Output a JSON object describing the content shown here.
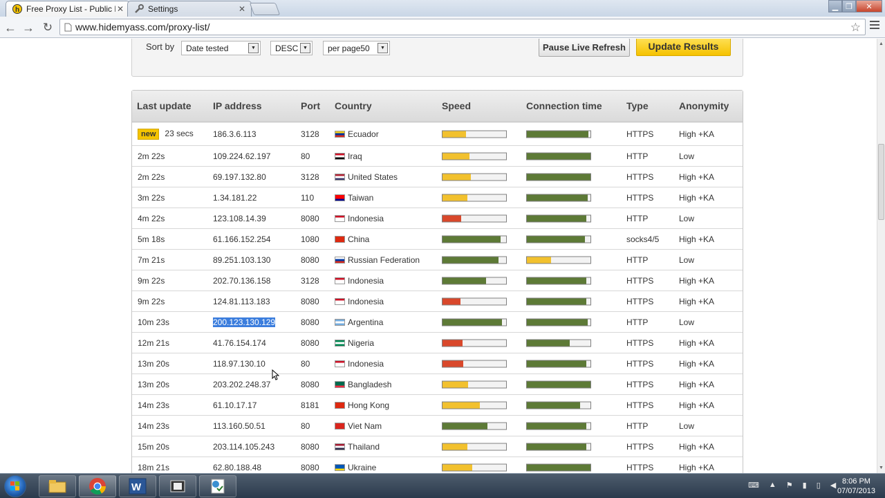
{
  "browser": {
    "tabs": [
      {
        "title": "Free Proxy List - Public Pro",
        "active": true
      },
      {
        "title": "Settings",
        "active": false
      }
    ],
    "url": "www.hidemyass.com/proxy-list/"
  },
  "filters": {
    "sort_by_label": "Sort by",
    "sort_field": "Date tested",
    "sort_order": "DESC",
    "per_page": "per page50",
    "pause_button": "Pause Live Refresh",
    "update_button": "Update Results"
  },
  "table": {
    "headers": [
      "Last update",
      "IP address",
      "Port",
      "Country",
      "Speed",
      "Connection time",
      "Type",
      "Anonymity"
    ],
    "new_badge": "new",
    "rows": [
      {
        "last_update": "23 secs",
        "ip": "186.3.6.113",
        "port": "3128",
        "country": "Ecuador",
        "speed": 0.37,
        "speed_color": "#f2c12e",
        "conn": 0.97,
        "conn_color": "#5d7a36",
        "type": "HTTPS",
        "anonymity": "High +KA",
        "is_new": true
      },
      {
        "last_update": "2m 22s",
        "ip": "109.224.62.197",
        "port": "80",
        "country": "Iraq",
        "speed": 0.42,
        "speed_color": "#f2c12e",
        "conn": 1.0,
        "conn_color": "#5d7a36",
        "type": "HTTP",
        "anonymity": "Low"
      },
      {
        "last_update": "2m 22s",
        "ip": "69.197.132.80",
        "port": "3128",
        "country": "United States",
        "speed": 0.45,
        "speed_color": "#f2c12e",
        "conn": 1.0,
        "conn_color": "#5d7a36",
        "type": "HTTPS",
        "anonymity": "High +KA"
      },
      {
        "last_update": "3m 22s",
        "ip": "1.34.181.22",
        "port": "110",
        "country": "Taiwan",
        "speed": 0.39,
        "speed_color": "#f2c12e",
        "conn": 0.96,
        "conn_color": "#5d7a36",
        "type": "HTTPS",
        "anonymity": "High +KA"
      },
      {
        "last_update": "4m 22s",
        "ip": "123.108.14.39",
        "port": "8080",
        "country": "Indonesia",
        "speed": 0.29,
        "speed_color": "#d9482b",
        "conn": 0.93,
        "conn_color": "#5d7a36",
        "type": "HTTP",
        "anonymity": "Low"
      },
      {
        "last_update": "5m 18s",
        "ip": "61.166.152.254",
        "port": "1080",
        "country": "China",
        "speed": 0.91,
        "speed_color": "#5d7a36",
        "conn": 0.91,
        "conn_color": "#5d7a36",
        "type": "socks4/5",
        "anonymity": "High +KA"
      },
      {
        "last_update": "7m 21s",
        "ip": "89.251.103.130",
        "port": "8080",
        "country": "Russian Federation",
        "speed": 0.88,
        "speed_color": "#5d7a36",
        "conn": 0.38,
        "conn_color": "#f2c12e",
        "type": "HTTP",
        "anonymity": "Low"
      },
      {
        "last_update": "9m 22s",
        "ip": "202.70.136.158",
        "port": "3128",
        "country": "Indonesia",
        "speed": 0.68,
        "speed_color": "#5d7a36",
        "conn": 0.93,
        "conn_color": "#5d7a36",
        "type": "HTTPS",
        "anonymity": "High +KA"
      },
      {
        "last_update": "9m 22s",
        "ip": "124.81.113.183",
        "port": "8080",
        "country": "Indonesia",
        "speed": 0.28,
        "speed_color": "#d9482b",
        "conn": 0.93,
        "conn_color": "#5d7a36",
        "type": "HTTPS",
        "anonymity": "High +KA"
      },
      {
        "last_update": "10m 23s",
        "ip": "200.123.130.129",
        "port": "8080",
        "country": "Argentina",
        "speed": 0.93,
        "speed_color": "#5d7a36",
        "conn": 0.96,
        "conn_color": "#5d7a36",
        "type": "HTTP",
        "anonymity": "Low",
        "selected": true
      },
      {
        "last_update": "12m 21s",
        "ip": "41.76.154.174",
        "port": "8080",
        "country": "Nigeria",
        "speed": 0.32,
        "speed_color": "#d9482b",
        "conn": 0.67,
        "conn_color": "#5d7a36",
        "type": "HTTPS",
        "anonymity": "High +KA"
      },
      {
        "last_update": "13m 20s",
        "ip": "118.97.130.10",
        "port": "80",
        "country": "Indonesia",
        "speed": 0.33,
        "speed_color": "#d9482b",
        "conn": 0.93,
        "conn_color": "#5d7a36",
        "type": "HTTPS",
        "anonymity": "High +KA"
      },
      {
        "last_update": "13m 20s",
        "ip": "203.202.248.37",
        "port": "8080",
        "country": "Bangladesh",
        "speed": 0.4,
        "speed_color": "#f2c12e",
        "conn": 1.0,
        "conn_color": "#5d7a36",
        "type": "HTTPS",
        "anonymity": "High +KA"
      },
      {
        "last_update": "14m 23s",
        "ip": "61.10.17.17",
        "port": "8181",
        "country": "Hong Kong",
        "speed": 0.59,
        "speed_color": "#f2c12e",
        "conn": 0.84,
        "conn_color": "#5d7a36",
        "type": "HTTPS",
        "anonymity": "High +KA"
      },
      {
        "last_update": "14m 23s",
        "ip": "113.160.50.51",
        "port": "80",
        "country": "Viet Nam",
        "speed": 0.71,
        "speed_color": "#5d7a36",
        "conn": 0.93,
        "conn_color": "#5d7a36",
        "type": "HTTP",
        "anonymity": "Low"
      },
      {
        "last_update": "15m 20s",
        "ip": "203.114.105.243",
        "port": "8080",
        "country": "Thailand",
        "speed": 0.39,
        "speed_color": "#f2c12e",
        "conn": 0.93,
        "conn_color": "#5d7a36",
        "type": "HTTPS",
        "anonymity": "High +KA"
      },
      {
        "last_update": "18m 21s",
        "ip": "62.80.188.48",
        "port": "8080",
        "country": "Ukraine",
        "speed": 0.47,
        "speed_color": "#f2c12e",
        "conn": 1.0,
        "conn_color": "#5d7a36",
        "type": "HTTPS",
        "anonymity": "High +KA"
      }
    ]
  },
  "flags": {
    "Ecuador": [
      "#f7d117",
      "#0033a0",
      "#d52b1e"
    ],
    "Iraq": [
      "#ce1126",
      "#ffffff",
      "#000000"
    ],
    "United States": [
      "#b22234",
      "#ffffff",
      "#3c3b6e"
    ],
    "Taiwan": [
      "#fe0000",
      "#fe0000",
      "#000095"
    ],
    "Indonesia": [
      "#ce1126",
      "#ffffff",
      "#ffffff"
    ],
    "China": [
      "#de2910",
      "#de2910",
      "#de2910"
    ],
    "Russian Federation": [
      "#ffffff",
      "#0039a6",
      "#d52b1e"
    ],
    "Argentina": [
      "#74acdf",
      "#ffffff",
      "#74acdf"
    ],
    "Nigeria": [
      "#008751",
      "#ffffff",
      "#008751"
    ],
    "Bangladesh": [
      "#006a4e",
      "#006a4e",
      "#f42a41"
    ],
    "Hong Kong": [
      "#de2910",
      "#de2910",
      "#de2910"
    ],
    "Viet Nam": [
      "#da251d",
      "#da251d",
      "#da251d"
    ],
    "Thailand": [
      "#a51931",
      "#f4f5f8",
      "#2d2a4a"
    ],
    "Ukraine": [
      "#0057b7",
      "#0057b7",
      "#ffd700"
    ]
  },
  "taskbar": {
    "time": "8:06 PM",
    "date": "07/07/2013",
    "apps": [
      "explorer-icon",
      "chrome-icon",
      "word-icon",
      "media-icon",
      "tools-icon"
    ]
  }
}
